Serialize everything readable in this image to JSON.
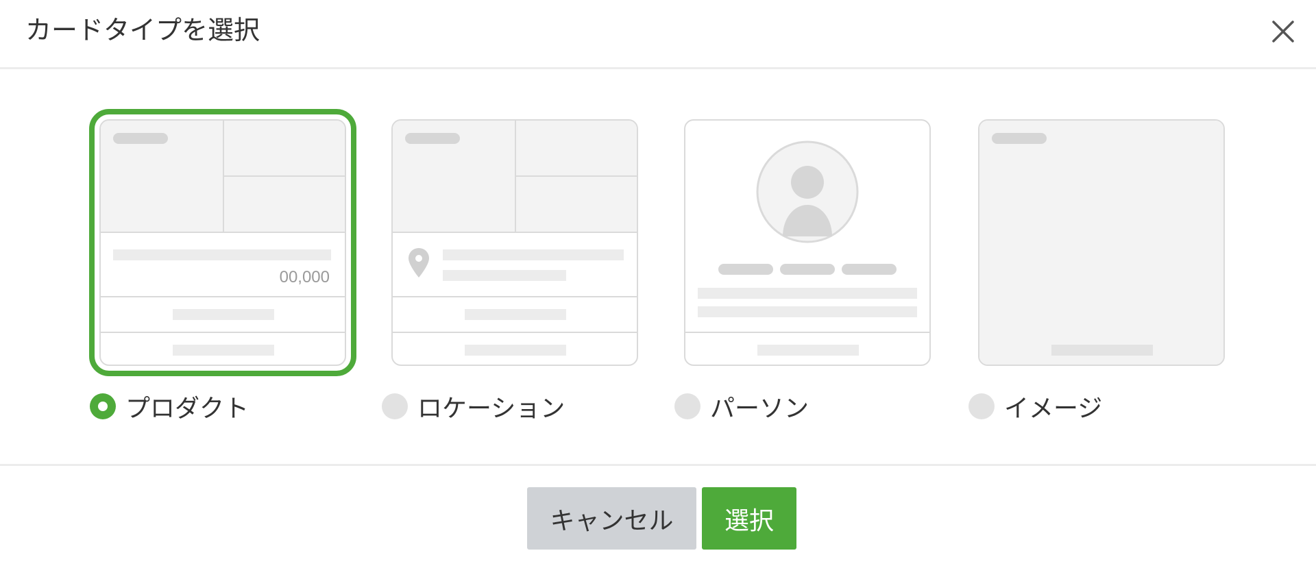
{
  "dialog": {
    "title": "カードタイプを選択",
    "close_icon": "close-icon"
  },
  "options": [
    {
      "label": "プロダクト",
      "selected": true,
      "price_text": "00,000"
    },
    {
      "label": "ロケーション",
      "selected": false
    },
    {
      "label": "パーソン",
      "selected": false
    },
    {
      "label": "イメージ",
      "selected": false
    }
  ],
  "footer": {
    "cancel_label": "キャンセル",
    "select_label": "選択"
  },
  "colors": {
    "accent": "#4eaa3a",
    "neutral_button": "#cfd2d6"
  }
}
